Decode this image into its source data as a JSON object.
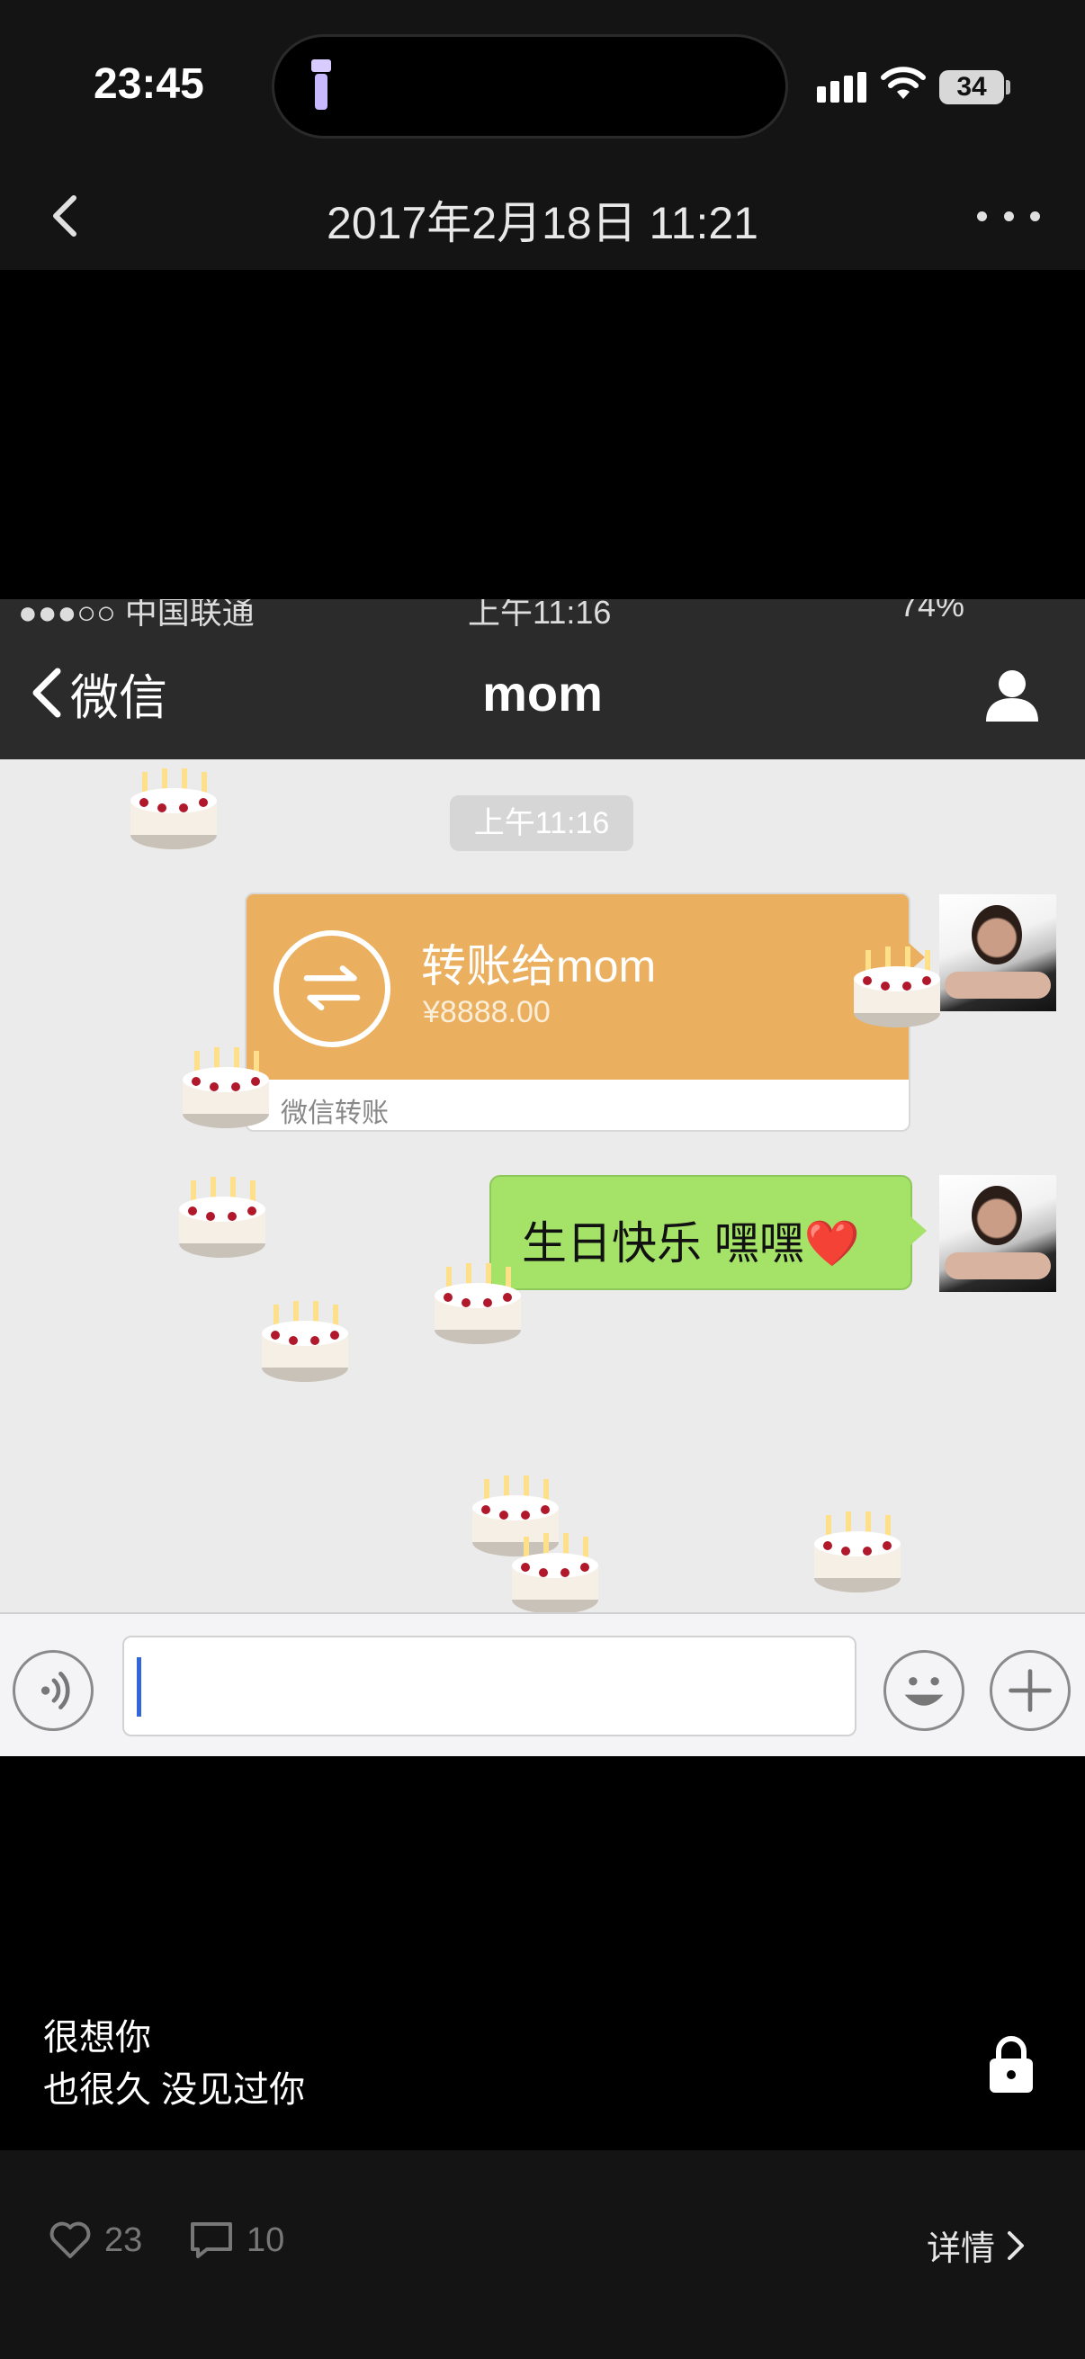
{
  "status_bar": {
    "time": "23:45",
    "battery": "34"
  },
  "nav": {
    "title": "2017年2月18日 11:21"
  },
  "screenshot": {
    "status_bar": {
      "carrier": "●●●○○ 中国联通",
      "time": "上午11:16",
      "battery": "74%"
    },
    "nav": {
      "back_label": "微信",
      "title": "mom"
    },
    "time_label": "上午11:16",
    "transfer": {
      "title": "转账给mom",
      "amount": "¥8888.00",
      "label": "微信转账"
    },
    "message": "生日快乐 嘿嘿❤️",
    "cake_emoji": "🎂",
    "colors": {
      "transfer": "#ebb05f",
      "bubble": "#a4e268",
      "nav_bg": "#2b2b2c"
    }
  },
  "caption": {
    "line1": "很想你",
    "line2": "也很久 没见过你"
  },
  "footer": {
    "likes": "23",
    "comments": "10",
    "detail_label": "详情"
  }
}
